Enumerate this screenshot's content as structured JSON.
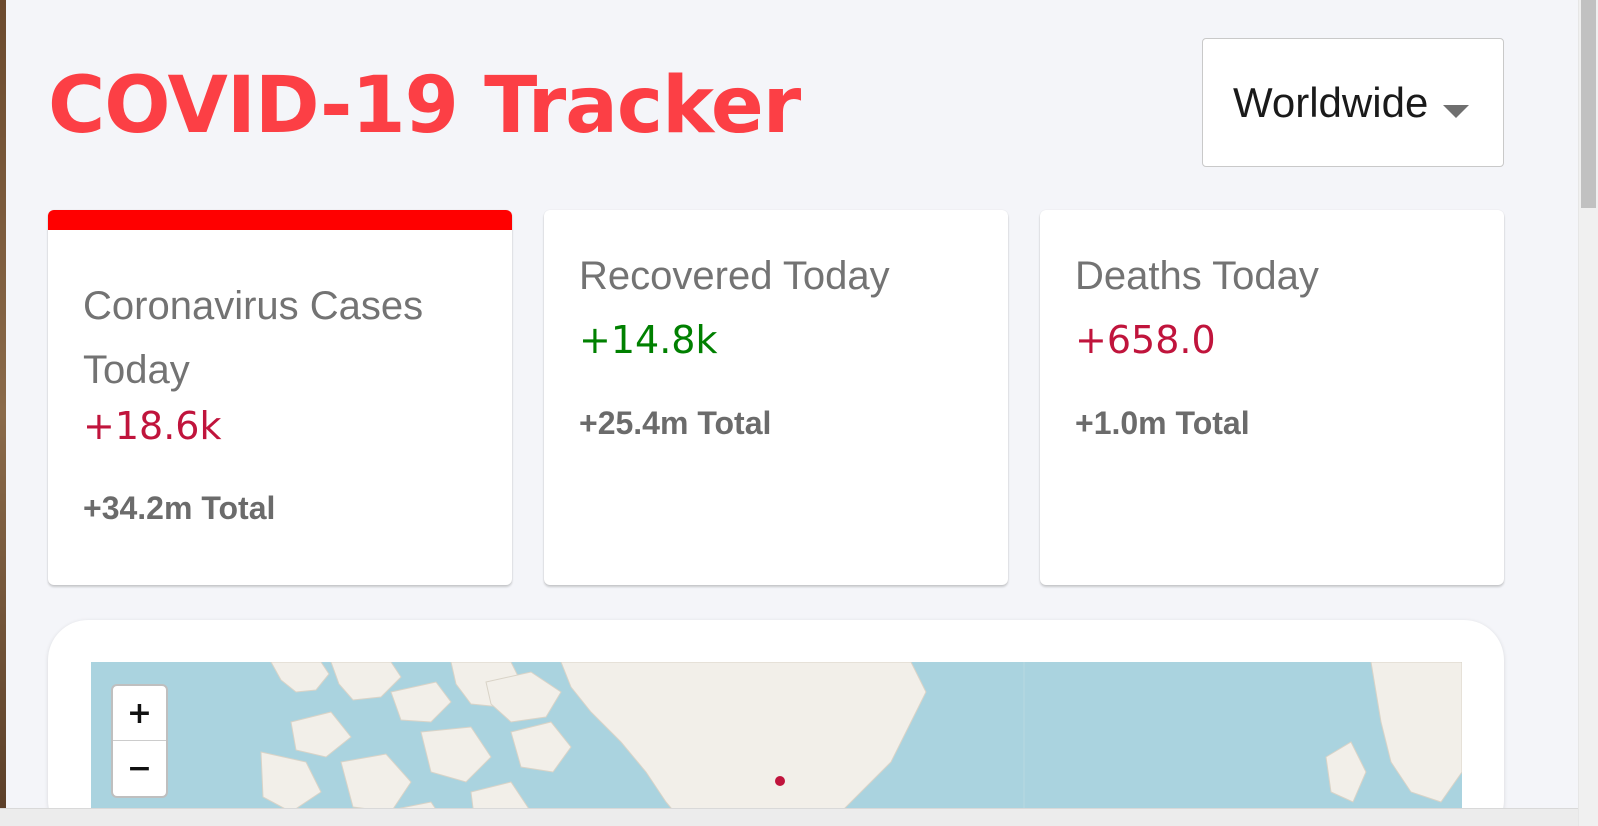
{
  "header": {
    "title": "COVID-19 Tracker",
    "region_select": {
      "value": "Worldwide"
    }
  },
  "cards": [
    {
      "title": "Coronavirus Cases Today",
      "today": "+18.6k",
      "total": "+34.2m Total",
      "today_color": "#c0143c",
      "selected": true
    },
    {
      "title": "Recovered Today",
      "today": "+14.8k",
      "total": "+25.4m Total",
      "today_color": "#008000",
      "selected": false
    },
    {
      "title": "Deaths Today",
      "today": "+658.0",
      "total": "+1.0m Total",
      "today_color": "#c0143c",
      "selected": false
    }
  ],
  "map": {
    "zoom_in": "+",
    "zoom_out": "−",
    "water_color": "#aad3df",
    "land_color": "#f2efe9",
    "marker_color": "#c0143c"
  },
  "colors": {
    "title": "#fc3f45",
    "selected_bar": "#ff0000",
    "background": "#f4f5f9"
  }
}
